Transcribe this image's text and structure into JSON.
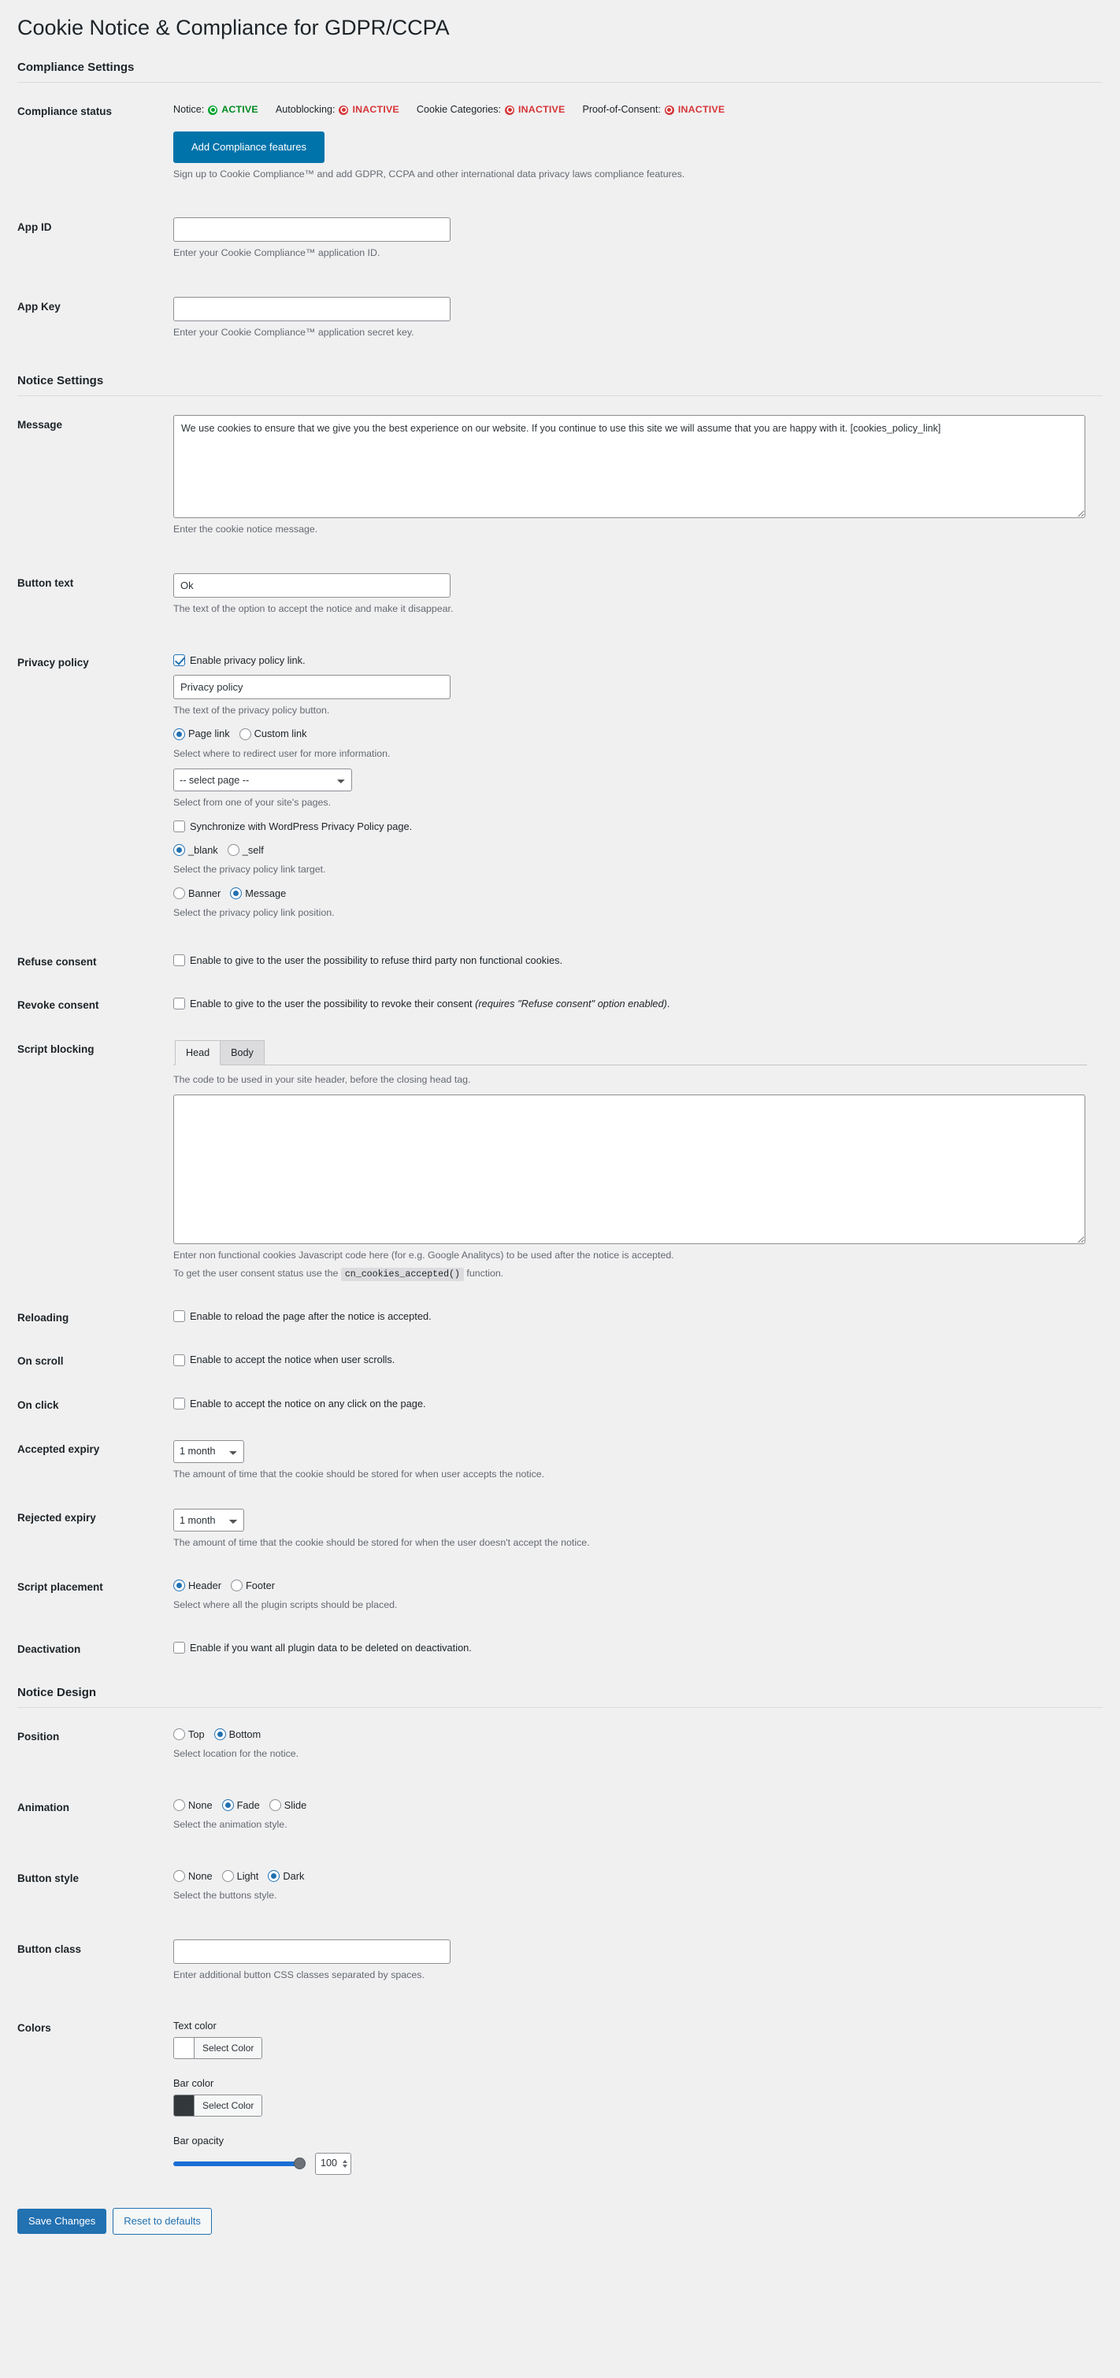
{
  "page": {
    "title": "Cookie Notice & Compliance for GDPR/CCPA"
  },
  "sections": {
    "compliance": "Compliance Settings",
    "notice": "Notice Settings",
    "design": "Notice Design"
  },
  "compliance": {
    "status_label": "Compliance status",
    "statuses": [
      {
        "name": "Notice:",
        "value": "ACTIVE",
        "state": "active"
      },
      {
        "name": "Autoblocking:",
        "value": "INACTIVE",
        "state": "inactive"
      },
      {
        "name": "Cookie Categories:",
        "value": "INACTIVE",
        "state": "inactive"
      },
      {
        "name": "Proof-of-Consent:",
        "value": "INACTIVE",
        "state": "inactive"
      }
    ],
    "add_features_button": "Add Compliance features",
    "add_features_desc": "Sign up to Cookie Compliance™ and add GDPR, CCPA and other international data privacy laws compliance features.",
    "app_id_label": "App ID",
    "app_id_value": "",
    "app_id_desc": "Enter your Cookie Compliance™ application ID.",
    "app_key_label": "App Key",
    "app_key_value": "",
    "app_key_desc": "Enter your Cookie Compliance™ application secret key."
  },
  "notice": {
    "message_label": "Message",
    "message_value": "We use cookies to ensure that we give you the best experience on our website. If you continue to use this site we will assume that you are happy with it. [cookies_policy_link]",
    "message_desc": "Enter the cookie notice message.",
    "button_text_label": "Button text",
    "button_text_value": "Ok",
    "button_text_desc": "The text of the option to accept the notice and make it disappear.",
    "privacy_label": "Privacy policy",
    "privacy_enable_label": "Enable privacy policy link.",
    "privacy_enable_checked": true,
    "privacy_text_value": "Privacy policy",
    "privacy_text_desc": "The text of the privacy policy button.",
    "link_type_page": "Page link",
    "link_type_custom": "Custom link",
    "link_type_selected": "page",
    "link_type_desc": "Select where to redirect user for more information.",
    "page_select_value": "-- select page --",
    "page_select_desc": "Select from one of your site's pages.",
    "sync_label": "Synchronize with WordPress Privacy Policy page.",
    "sync_checked": false,
    "target_blank": "_blank",
    "target_self": "_self",
    "target_selected": "_blank",
    "target_desc": "Select the privacy policy link target.",
    "position_banner": "Banner",
    "position_message": "Message",
    "position_selected": "message",
    "position_desc": "Select the privacy policy link position.",
    "refuse_label": "Refuse consent",
    "refuse_text": "Enable to give to the user the possibility to refuse third party non functional cookies.",
    "refuse_checked": false,
    "revoke_label": "Revoke consent",
    "revoke_text_main": "Enable to give to the user the possibility to revoke their consent ",
    "revoke_text_em": "(requires \"Refuse consent\" option enabled)",
    "revoke_text_end": ".",
    "revoke_checked": false,
    "script_blocking_label": "Script blocking",
    "tab_head": "Head",
    "tab_body": "Body",
    "active_tab": "Head",
    "script_tab_desc": "The code to be used in your site header, before the closing head tag.",
    "script_value": "",
    "script_desc_line1": "Enter non functional cookies Javascript code here (for e.g. Google Analitycs) to be used after the notice is accepted.",
    "script_desc_line2_pre": "To get the user consent status use the ",
    "script_desc_code": "cn_cookies_accepted()",
    "script_desc_line2_post": " function.",
    "reloading_label": "Reloading",
    "reloading_text": "Enable to reload the page after the notice is accepted.",
    "reloading_checked": false,
    "onscroll_label": "On scroll",
    "onscroll_text": "Enable to accept the notice when user scrolls.",
    "onscroll_checked": false,
    "onclick_label": "On click",
    "onclick_text": "Enable to accept the notice on any click on the page.",
    "onclick_checked": false,
    "accepted_expiry_label": "Accepted expiry",
    "accepted_expiry_value": "1 month",
    "accepted_expiry_desc": "The amount of time that the cookie should be stored for when user accepts the notice.",
    "rejected_expiry_label": "Rejected expiry",
    "rejected_expiry_value": "1 month",
    "rejected_expiry_desc": "The amount of time that the cookie should be stored for when the user doesn't accept the notice.",
    "placement_label": "Script placement",
    "placement_header": "Header",
    "placement_footer": "Footer",
    "placement_selected": "header",
    "placement_desc": "Select where all the plugin scripts should be placed.",
    "deactivation_label": "Deactivation",
    "deactivation_text": "Enable if you want all plugin data to be deleted on deactivation.",
    "deactivation_checked": false
  },
  "design": {
    "position_label": "Position",
    "position_top": "Top",
    "position_bottom": "Bottom",
    "position_selected": "bottom",
    "position_desc": "Select location for the notice.",
    "animation_label": "Animation",
    "animation_none": "None",
    "animation_fade": "Fade",
    "animation_slide": "Slide",
    "animation_selected": "fade",
    "animation_desc": "Select the animation style.",
    "button_style_label": "Button style",
    "button_style_none": "None",
    "button_style_light": "Light",
    "button_style_dark": "Dark",
    "button_style_selected": "dark",
    "button_style_desc": "Select the buttons style.",
    "button_class_label": "Button class",
    "button_class_value": "",
    "button_class_desc": "Enter additional button CSS classes separated by spaces.",
    "colors_label": "Colors",
    "text_color_label": "Text color",
    "text_color_button": "Select Color",
    "text_color_value": "#ffffff",
    "bar_color_label": "Bar color",
    "bar_color_button": "Select Color",
    "bar_color_value": "#32373c",
    "bar_opacity_label": "Bar opacity",
    "bar_opacity_value": "100"
  },
  "footer": {
    "save_label": "Save Changes",
    "reset_label": "Reset to defaults"
  }
}
